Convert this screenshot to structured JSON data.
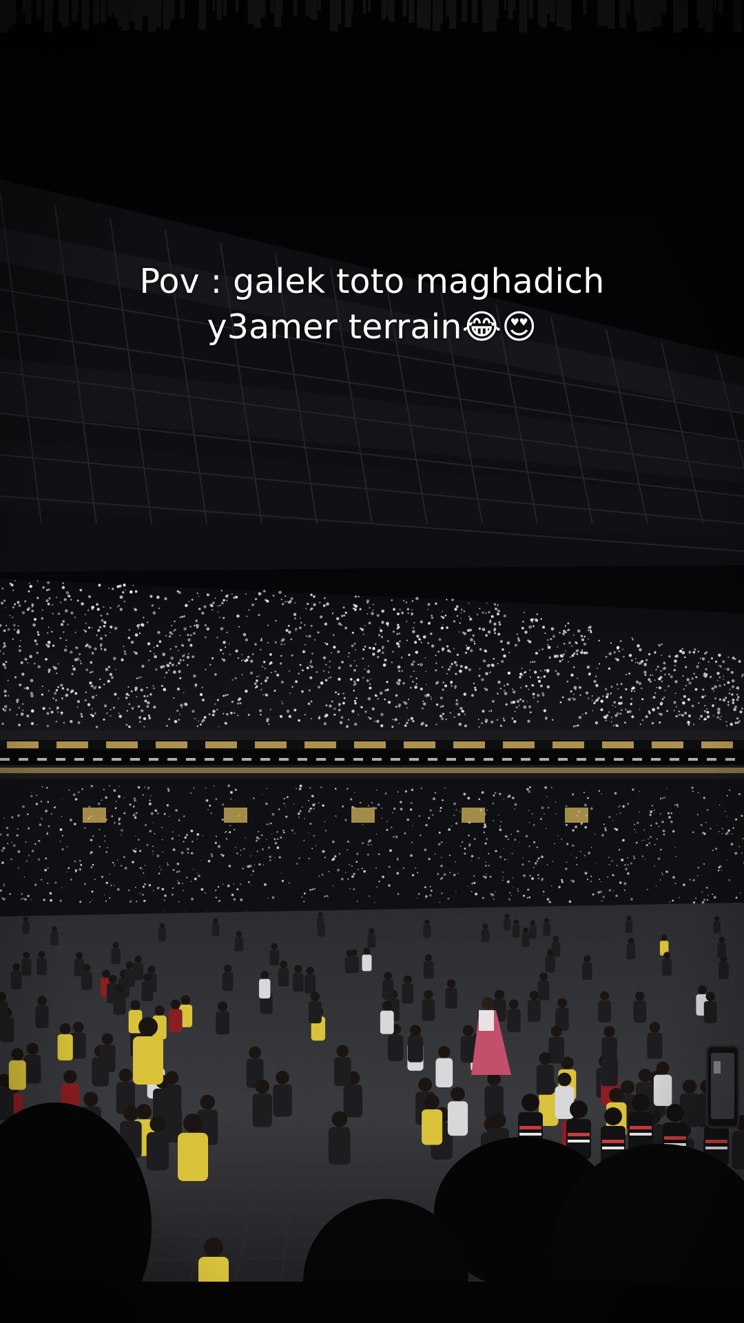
{
  "caption": {
    "line1": "Pov : galek toto maghadich",
    "line2": "y3amer terrain😂😍"
  },
  "palette": {
    "background": "#030304",
    "roof": "#141519",
    "crowd_light": "#e8e4f4",
    "suite_light": "#d6b45e",
    "pitch_floor": "#2e2f33",
    "steward_vest": "#d9c23a",
    "dress": "#c44f6a"
  },
  "scene": {
    "description_icon": "stadium-crowd-photo"
  }
}
